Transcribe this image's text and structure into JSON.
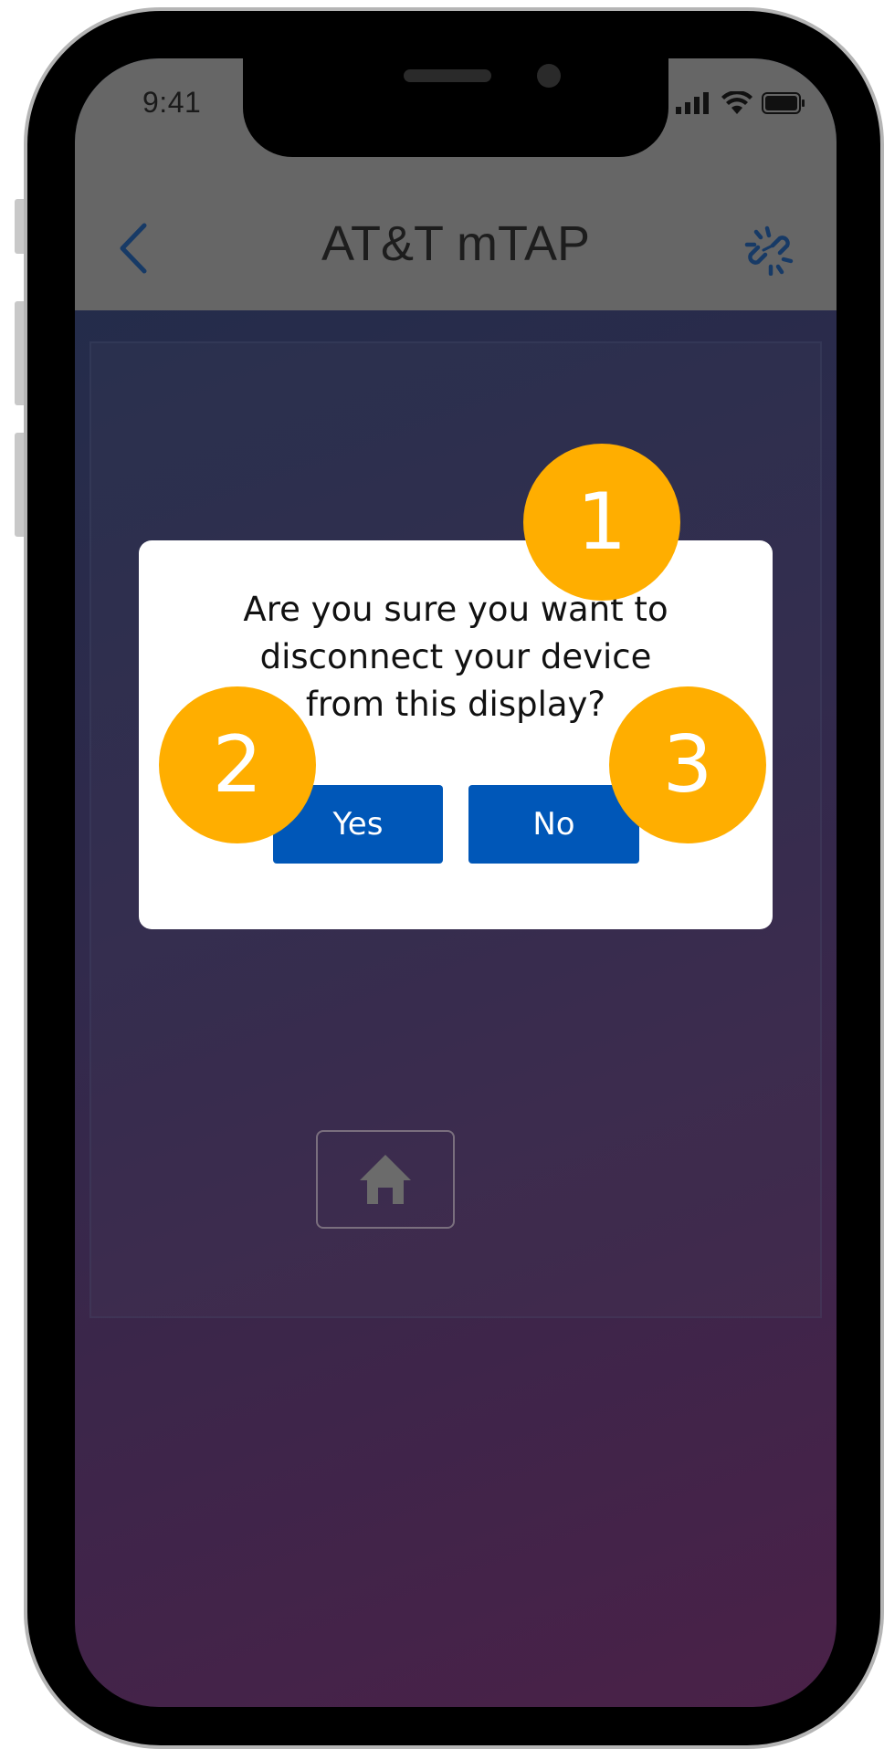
{
  "status_bar": {
    "time": "9:41"
  },
  "header": {
    "title": "AT&T mTAP",
    "back_icon": "chevron-left-icon",
    "unlink_icon": "unlink-icon"
  },
  "dialog": {
    "message": "Are you sure you want to\ndisconnect your device\nfrom this display?",
    "yes_label": "Yes",
    "no_label": "No"
  },
  "markers": [
    "1",
    "2",
    "3"
  ],
  "footer": {
    "home_icon": "home-icon"
  },
  "colors": {
    "accent_blue": "#0057b8",
    "marker_orange": "#ffae00",
    "header_dim": "#666666",
    "gradient_top": "#1f2d4a",
    "gradient_bottom": "#4a2148"
  }
}
